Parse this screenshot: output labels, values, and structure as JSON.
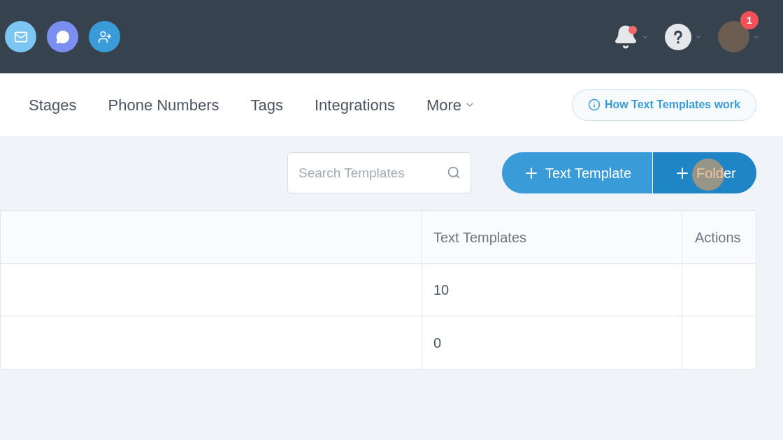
{
  "header": {
    "apps": [
      {
        "kind": "mail"
      },
      {
        "kind": "chat"
      },
      {
        "kind": "contact"
      }
    ],
    "notifications": {
      "unread": true
    },
    "profile_badge": "1"
  },
  "nav": {
    "items": [
      {
        "label": "Stages",
        "kind": "link"
      },
      {
        "label": "Phone Numbers",
        "kind": "link"
      },
      {
        "label": "Tags",
        "kind": "link"
      },
      {
        "label": "Integrations",
        "kind": "link"
      },
      {
        "label": "More",
        "kind": "menu"
      }
    ],
    "help_button": "How Text Templates work"
  },
  "toolbar": {
    "search": {
      "placeholder": "Search Templates"
    },
    "buttons": [
      {
        "label": "Text Template",
        "kind": "primary"
      },
      {
        "label": "Folder",
        "kind": "secondary",
        "clicked": true
      }
    ]
  },
  "table": {
    "columns": [
      "Text Templates",
      "Actions"
    ],
    "rows": [
      {
        "count": "10"
      },
      {
        "count": "0"
      }
    ]
  }
}
